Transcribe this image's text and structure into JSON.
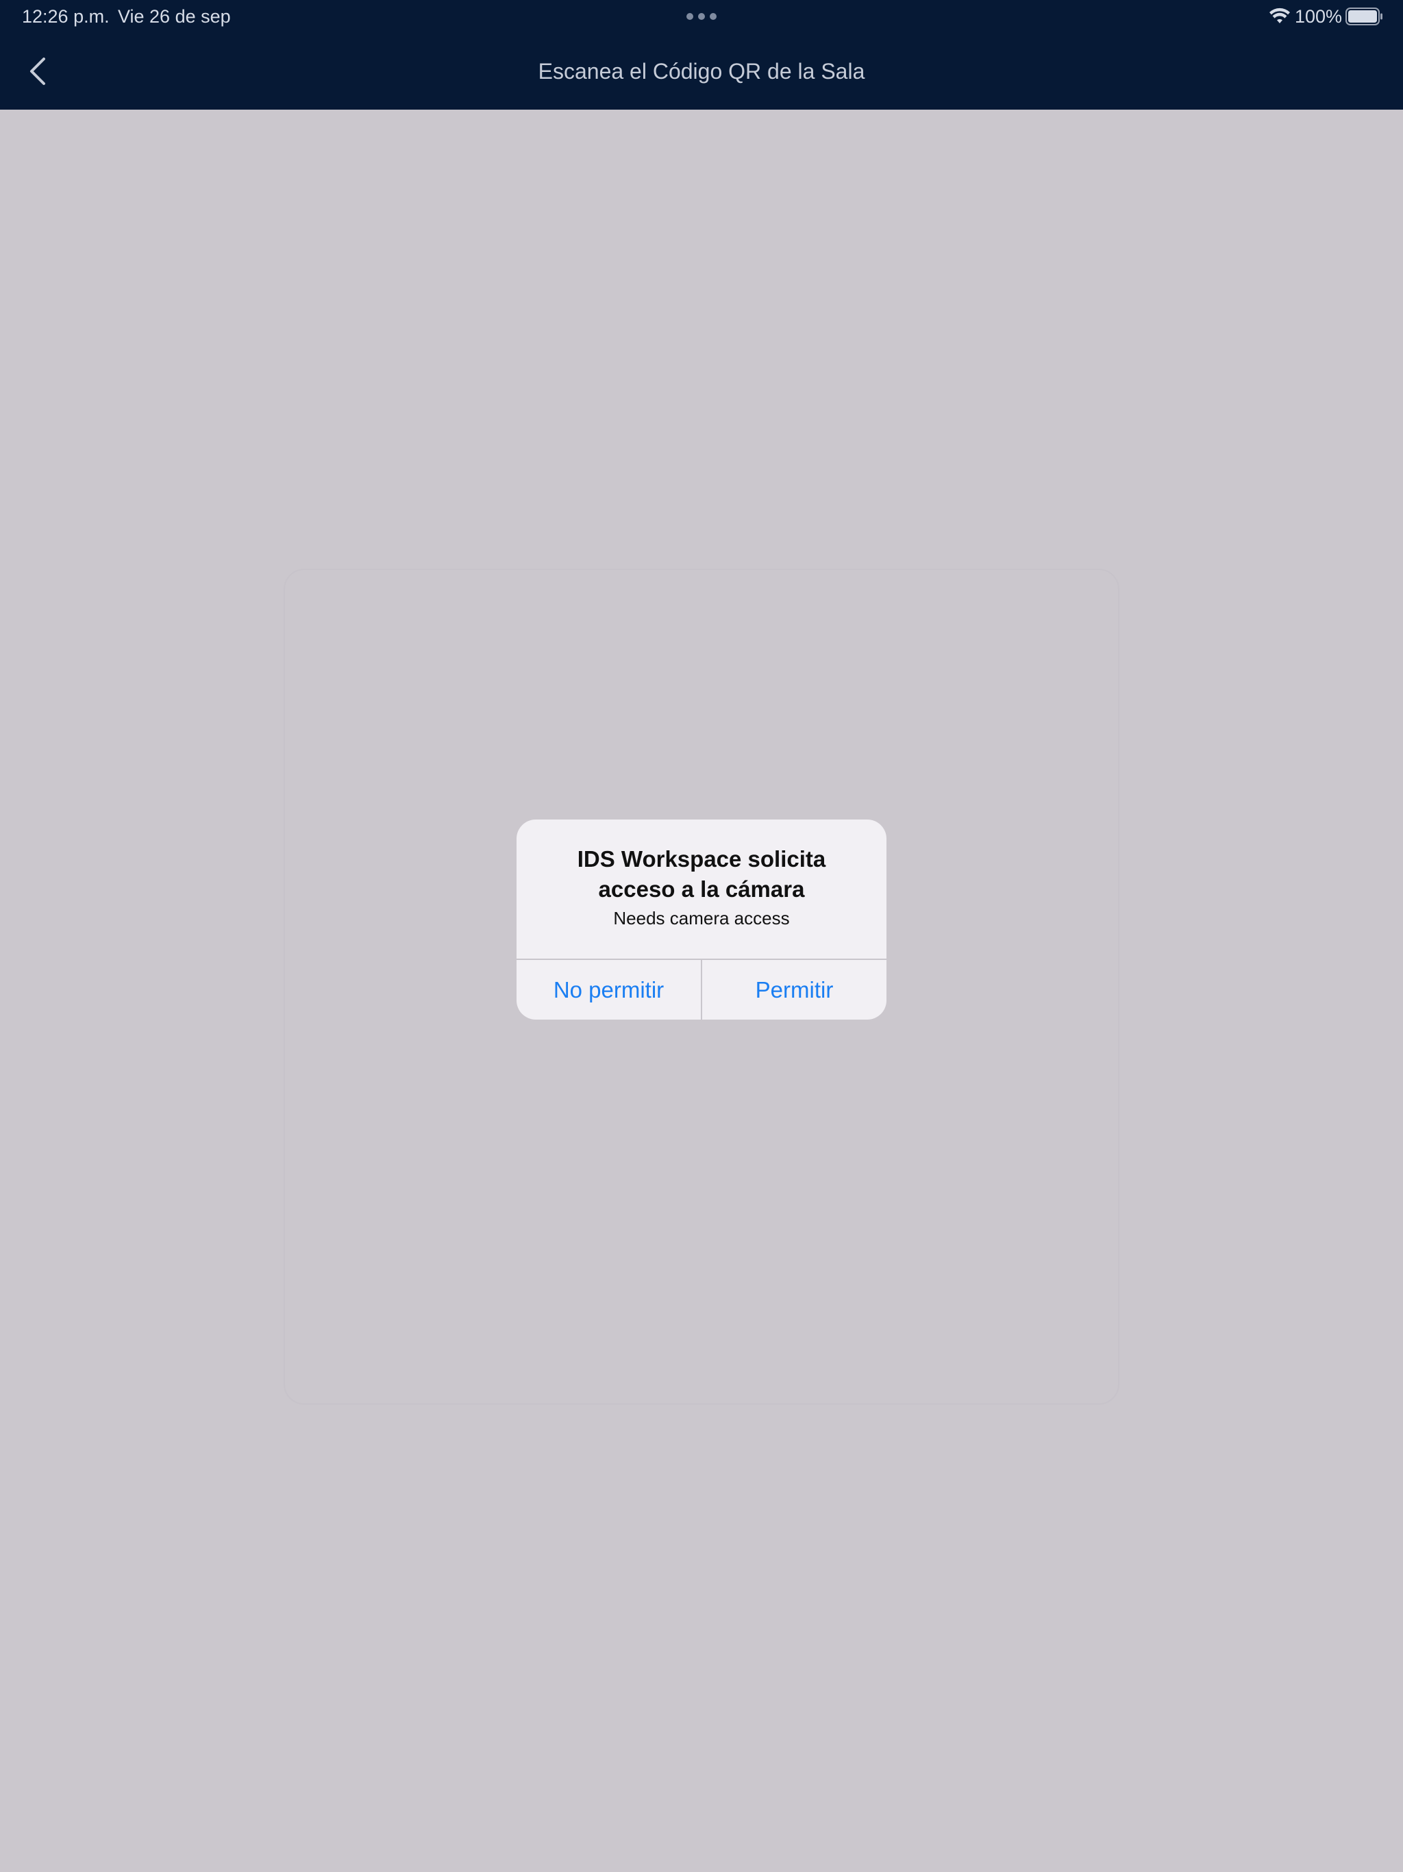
{
  "status_bar": {
    "time": "12:26 p.m.",
    "date": "Vie 26 de sep",
    "battery_percent": "100%",
    "battery_level": 1.0,
    "icons": [
      "wifi-icon",
      "battery-icon",
      "multitask-dots-icon"
    ]
  },
  "nav": {
    "back_icon": "chevron-left-icon",
    "title": "Escanea el Código QR de la Sala"
  },
  "alert": {
    "title": "IDS Workspace solicita\nacceso a la cámara",
    "message": "Needs camera access",
    "deny_label": "No permitir",
    "allow_label": "Permitir"
  },
  "colors": {
    "top_bar": "#061935",
    "background": "#cbc7cd",
    "alert_bg": "#f2f0f4",
    "accent": "#1a7ef2"
  }
}
